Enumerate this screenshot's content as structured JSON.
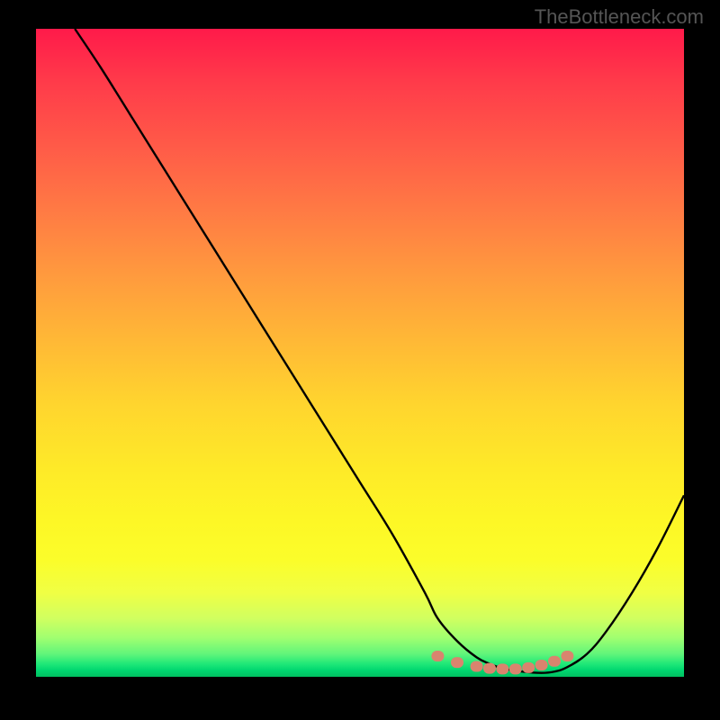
{
  "watermark": "TheBottleneck.com",
  "chart_data": {
    "type": "line",
    "title": "",
    "xlabel": "",
    "ylabel": "",
    "xlim": [
      0,
      100
    ],
    "ylim": [
      0,
      100
    ],
    "series": [
      {
        "name": "bottleneck-curve",
        "x": [
          6,
          10,
          15,
          20,
          25,
          30,
          35,
          40,
          45,
          50,
          55,
          60,
          62,
          65,
          68,
          70,
          72,
          75,
          78,
          80,
          82,
          85,
          88,
          92,
          96,
          100
        ],
        "y": [
          100,
          94,
          86,
          78,
          70,
          62,
          54,
          46,
          38,
          30,
          22,
          13,
          9,
          5.5,
          3,
          2,
          1.3,
          0.8,
          0.6,
          0.8,
          1.5,
          3.5,
          7,
          13,
          20,
          28
        ]
      }
    ],
    "markers": {
      "name": "highlight-band",
      "color": "#d9846e",
      "points": [
        {
          "x": 62,
          "y": 3.2
        },
        {
          "x": 65,
          "y": 2.2
        },
        {
          "x": 68,
          "y": 1.6
        },
        {
          "x": 70,
          "y": 1.3
        },
        {
          "x": 72,
          "y": 1.2
        },
        {
          "x": 74,
          "y": 1.2
        },
        {
          "x": 76,
          "y": 1.4
        },
        {
          "x": 78,
          "y": 1.8
        },
        {
          "x": 80,
          "y": 2.4
        },
        {
          "x": 82,
          "y": 3.2
        }
      ]
    }
  }
}
